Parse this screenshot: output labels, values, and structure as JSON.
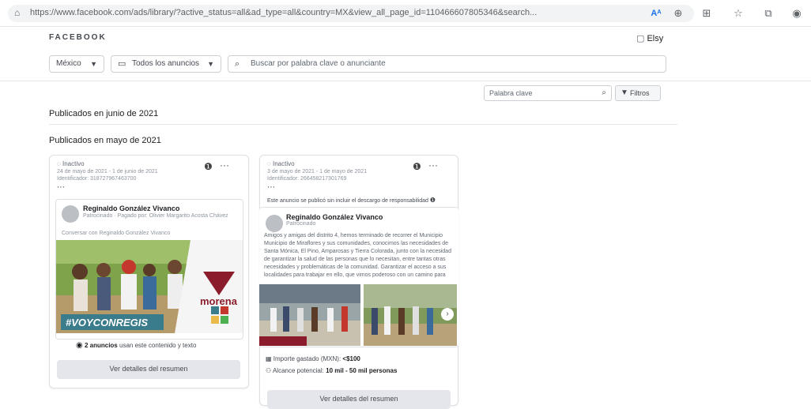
{
  "browser": {
    "url": "https://www.facebook.com/ads/library/?active_status=all&ad_type=all&country=MX&view_all_page_id=110466607805346&search..."
  },
  "header": {
    "brand": "FACEBOOK",
    "user_name": "Elsy"
  },
  "filters": {
    "country": "México",
    "ad_category": "Todos los anuncios",
    "search_placeholder": "Buscar por palabra clave o anunciante",
    "keyword_placeholder": "Palabra clave",
    "filters_button": "Filtros"
  },
  "sections": {
    "june": "Publicados en junio de 2021",
    "may": "Publicados en mayo de 2021"
  },
  "cards": [
    {
      "status": "Inactivo",
      "dates": "24 de mayo de 2021 - 1 de junio de 2021",
      "identifier": "Identificador: 318727967463700",
      "page_name": "Reginaldo González Vivanco",
      "page_sub": "Patrocinado · Pagado por: Olivier Margarito Acosta Chávez",
      "post_text": "Conversar con Reginaldo González Vivanco",
      "image_text": {
        "party": "morena",
        "hashtag": "#VOYCONREGIS"
      },
      "multi_ads_note_bold": "2 anuncios",
      "multi_ads_note_rest": "usan este contenido y texto",
      "details_button": "Ver detalles del resumen"
    },
    {
      "status": "Inactivo",
      "dates": "3 de mayo de 2021 - 1 de mayo de 2021",
      "identifier": "Identificador: 266458217301769",
      "disclaimer": "Este anuncio se publicó sin incluir el descargo de responsabilidad",
      "page_name": "Reginaldo González Vivanco",
      "page_sub": "Patrocinado",
      "post_text": "Amigos y amigas del distrito 4, hemos terminado de recorrer el Municipio Municipio de Miraflores y sus comunidades, conocimos las necesidades de Santa Mónica, El Pino, Amparosas y Tierra Colorada, junto con la necesidad de garantizar la salud de las personas que lo necesitan, entre tantas otras necesidades y problemáticas de la comunidad. Garantizar el acceso a sus localidades para trabajar en ello, que vimos poderoso con un camino para ver algunas vía y más...",
      "spend_label": "Importe gastado (MXN):",
      "spend_value": "<$100",
      "reach_label": "Alcance potencial:",
      "reach_value": "10 mil - 50 mil personas",
      "details_button": "Ver detalles del resumen"
    }
  ],
  "colors": {
    "accent": "#1877f2",
    "morena": "#8b1c2c",
    "hashtag_bg": "#3a7b8c"
  }
}
